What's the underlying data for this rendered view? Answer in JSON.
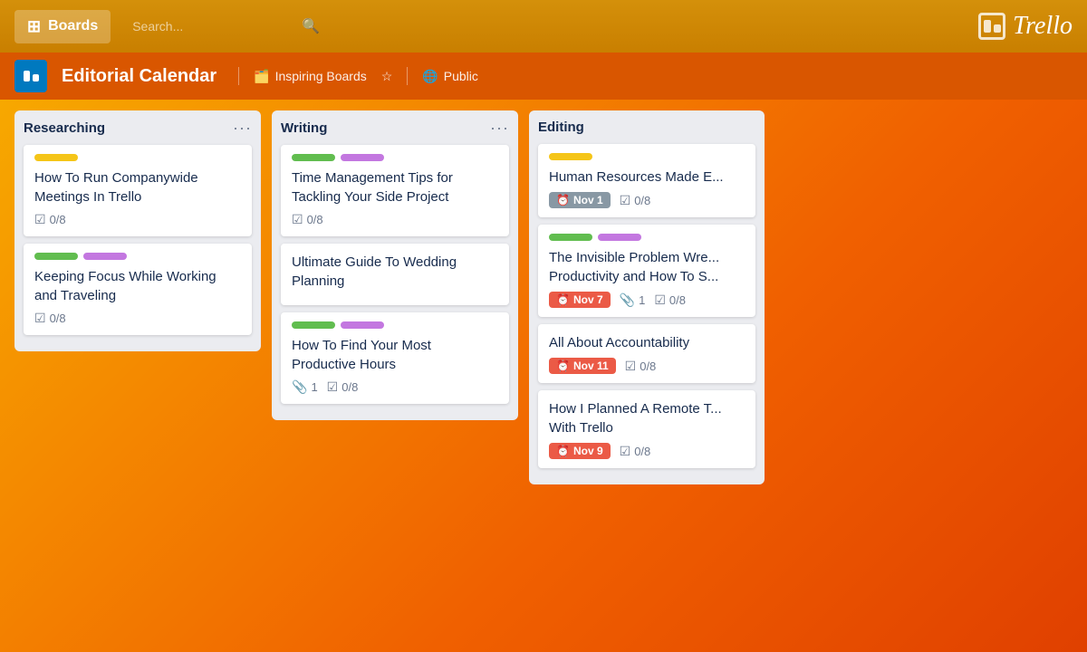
{
  "nav": {
    "boards_label": "Boards",
    "search_placeholder": "Search...",
    "logo_text": "Trello"
  },
  "board": {
    "title": "Editorial Calendar",
    "team": "Inspiring Boards",
    "visibility": "Public"
  },
  "columns": [
    {
      "id": "researching",
      "title": "Researching",
      "cards": [
        {
          "id": "card1",
          "labels": [
            "yellow"
          ],
          "title": "How To Run Companywide Meetings In Trello",
          "checklist": "0/8"
        },
        {
          "id": "card2",
          "labels": [
            "green",
            "purple"
          ],
          "title": "Keeping Focus While Working and Traveling",
          "checklist": "0/8"
        }
      ]
    },
    {
      "id": "writing",
      "title": "Writing",
      "cards": [
        {
          "id": "card3",
          "labels": [
            "green",
            "purple"
          ],
          "title": "Time Management Tips for Tackling Your Side Project",
          "checklist": "0/8"
        },
        {
          "id": "card4",
          "labels": [],
          "title": "Ultimate Guide To Wedding Planning",
          "checklist": null
        },
        {
          "id": "card5",
          "labels": [
            "green",
            "purple"
          ],
          "title": "How To Find Your Most Productive Hours",
          "attachments": "1",
          "checklist": "0/8"
        }
      ]
    },
    {
      "id": "editing",
      "title": "Editing",
      "cards": [
        {
          "id": "card6",
          "labels": [
            "yellow"
          ],
          "title": "Human Resources Made E...",
          "date": "Nov 1",
          "date_color": "gray",
          "checklist": "0/8"
        },
        {
          "id": "card7",
          "labels": [
            "green",
            "purple"
          ],
          "title": "The Invisible Problem Wre... Productivity and How To S...",
          "date": "Nov 7",
          "date_color": "red",
          "attachments": "1",
          "checklist": "0/8"
        },
        {
          "id": "card8",
          "labels": [],
          "title": "All About Accountability",
          "date": "Nov 11",
          "date_color": "red",
          "checklist": "0/8"
        },
        {
          "id": "card9",
          "labels": [],
          "title": "How I Planned A Remote T... With Trello",
          "date": "Nov 9",
          "date_color": "red",
          "checklist": "0/8"
        }
      ]
    }
  ]
}
